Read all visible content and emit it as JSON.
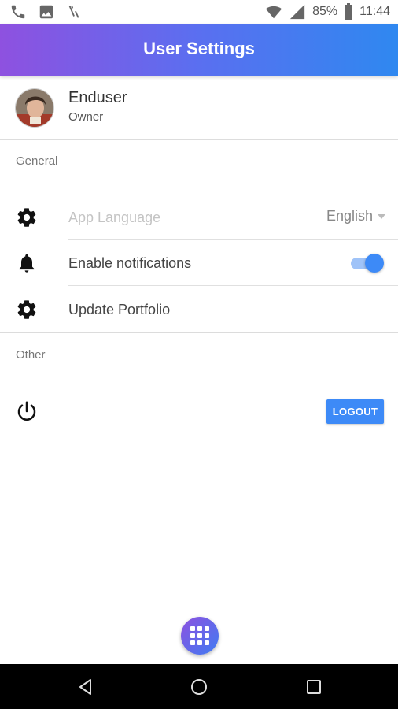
{
  "status_bar": {
    "battery": "85%",
    "time": "11:44",
    "icons": [
      "phone-icon",
      "image-icon",
      "missed-call-icon",
      "wifi-icon",
      "signal-icon",
      "battery-icon"
    ]
  },
  "app_bar": {
    "title": "User Settings",
    "gradient": [
      "#8e51e0",
      "#2f88f0"
    ]
  },
  "profile": {
    "name": "Enduser",
    "role": "Owner"
  },
  "sections": {
    "general": "General",
    "other": "Other"
  },
  "settings": {
    "app_language": {
      "label": "App Language",
      "value": "English",
      "icon": "gear-icon"
    },
    "notifications": {
      "label": "Enable notifications",
      "enabled": true,
      "icon": "bell-icon"
    },
    "portfolio": {
      "label": "Update Portfolio",
      "icon": "gear-icon"
    }
  },
  "logout": {
    "label": "LOGOUT",
    "icon": "power-icon"
  },
  "fab": {
    "icon": "apps-grid-icon"
  },
  "nav_bar": {
    "icons": [
      "back-icon",
      "home-icon",
      "recents-icon"
    ]
  },
  "colors": {
    "accent": "#3d8af7",
    "toggle_track": "#9fc3f8"
  }
}
